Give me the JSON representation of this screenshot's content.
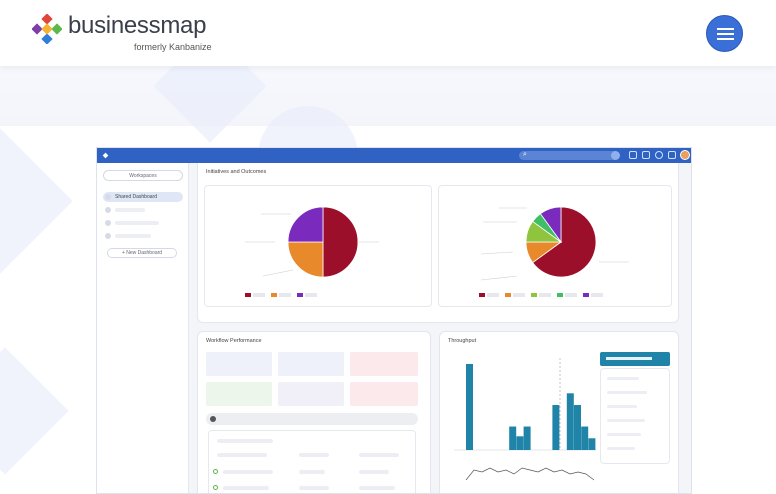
{
  "brand": {
    "name": "businessmap",
    "tagline": "formerly Kanbanize",
    "colors": {
      "accent": "#3b6fd8",
      "logo_purple": "#7b3fa6",
      "logo_green": "#5bb84b",
      "logo_red": "#e0463a",
      "logo_blue": "#2f7ed8"
    }
  },
  "header": {
    "menu_icon": "hamburger-icon"
  },
  "app": {
    "sidebar": {
      "workspaces_label": "Workspaces",
      "items": [
        {
          "label": "Shared Dashboard",
          "active": true
        },
        {
          "label": ""
        },
        {
          "label": ""
        },
        {
          "label": ""
        }
      ],
      "new_dashboard_label": "+ New Dashboard"
    },
    "initiatives": {
      "title": "Initiatives and Outcomes"
    },
    "workflow": {
      "title": "Workflow Performance"
    },
    "throughput": {
      "title": "Throughput"
    }
  },
  "chart_data": [
    {
      "type": "pie",
      "slices": [
        {
          "name": "",
          "value": 50,
          "color": "#9c0f2a"
        },
        {
          "name": "",
          "value": 25,
          "color": "#e8892b"
        },
        {
          "name": "",
          "value": 25,
          "color": "#7a2bbd"
        }
      ]
    },
    {
      "type": "pie",
      "slices": [
        {
          "name": "",
          "value": 65,
          "color": "#9c0f2a"
        },
        {
          "name": "",
          "value": 10,
          "color": "#e8892b"
        },
        {
          "name": "",
          "value": 10,
          "color": "#8fc43f"
        },
        {
          "name": "",
          "value": 5,
          "color": "#3fbf64"
        },
        {
          "name": "",
          "value": 10,
          "color": "#7a2bbd"
        }
      ]
    },
    {
      "type": "bar",
      "values": [
        88,
        0,
        0,
        0,
        0,
        0,
        24,
        14,
        24,
        0,
        0,
        0,
        46,
        0,
        58,
        46,
        24,
        12
      ]
    }
  ]
}
